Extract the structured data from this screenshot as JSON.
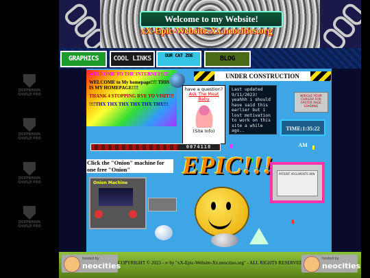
{
  "header": {
    "welcome": "Welcome to my Website!",
    "site_name": "xX-Epic-Website-Xx.neocities.org"
  },
  "nav": {
    "graphics": "GRAPHICS",
    "cool_links": "COOL LINKS",
    "our_cat": "OUR CAT ZOE",
    "blog": "BLOG"
  },
  "watermark": "DEEPBRAIN SHIELD PRO",
  "intro": {
    "line1": "WELCOME TO THE INTERNET!!!!!",
    "line2": "WELCOME to My homepage!!!! THIS IS MY HOMEPAGE!!!!",
    "line3": "THANK 4 STOPPING BYE TO VISIT!!!",
    "line4": "!!!!THX THX THX THX THX THX!!!"
  },
  "under_construction": "UNDER CONSTRUCTION",
  "question_box": {
    "title": "have a question?",
    "link": "Ask The Meat Baby",
    "caption": "(Site Info)"
  },
  "update_note": "Last updated 9/11/2023! yeahhh i should have said this earlier but i lost motivation to work on this site a while ago..",
  "widget_text": "WIGGLE YOUR CURSOR FOR FASTER PAGE LOADING",
  "time_label": "TIME:1:35:22 AM",
  "counter_value": "0074118",
  "onion": {
    "text": "Click the \"Onion\" machine for one free \"Onion\"",
    "machine_label": "Onion Machine"
  },
  "epic_text": "EPIC!!!",
  "frame_text": "PATIENT ARGUMENTS WIN",
  "footer": {
    "hosted_by": "hosted by",
    "neocities": "neocities",
    "copyright": "COPYRIGHT © 2023 - ∞ by \"xX-Epic-Website-Xx.neocities.org\" - ALL RIGHTS RESERVED"
  },
  "colors": {
    "nav_graphics": "#1c9a2a",
    "nav_cool": "#1b1b1b",
    "nav_cat": "#35c5e4",
    "nav_blog": "#4a6a1a",
    "content_bg": "#3ea6e4"
  }
}
